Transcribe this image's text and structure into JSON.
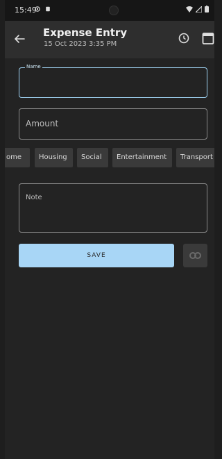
{
  "status_bar": {
    "time": "15:49"
  },
  "app_bar": {
    "title": "Expense Entry",
    "subtitle": "15 Oct 2023 3:35 PM"
  },
  "form": {
    "name_label": "Name",
    "amount_placeholder": "Amount",
    "note_placeholder": "Note",
    "save_label": "SAVE"
  },
  "categories": [
    "ome",
    "Housing",
    "Social",
    "Entertainment",
    "Transport"
  ],
  "colors": {
    "accent": "#a8d6f6",
    "focus_border": "#9fd3f3",
    "background": "#232323"
  }
}
